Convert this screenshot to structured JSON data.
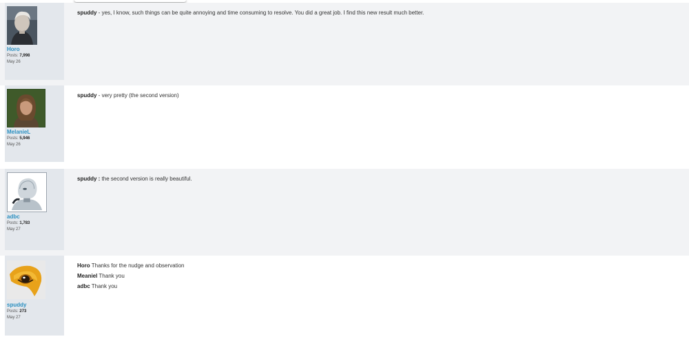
{
  "posts": [
    {
      "user": "Horo",
      "posts_label": "Posts:",
      "posts_count": "7,998",
      "date": "May 26",
      "lines": [
        {
          "bold": "spuddy",
          "text": " - yes, I know, such things can be quite annoying and time consuming to resolve. You did a great job. I find this new result much better."
        }
      ]
    },
    {
      "user": "MelanieL",
      "posts_label": "Posts:",
      "posts_count": "5,946",
      "date": "May 26",
      "lines": [
        {
          "bold": "spuddy",
          "text": " - very pretty (the second version)"
        }
      ]
    },
    {
      "user": "adbc",
      "posts_label": "Posts:",
      "posts_count": "1,783",
      "date": "May 27",
      "lines": [
        {
          "bold": "spuddy :",
          "text": " the second version is really beautiful."
        }
      ]
    },
    {
      "user": "spuddy",
      "posts_label": "Posts:",
      "posts_count": "273",
      "date": "May 27",
      "lines": [
        {
          "bold": "Horo",
          "text": " Thanks for the nudge and observation"
        },
        {
          "bold": "Meaniel",
          "text": "  Thank you"
        },
        {
          "bold": "adbc",
          "text": "  Thank you"
        }
      ]
    }
  ],
  "colors": {
    "username": "#2a8fc0",
    "user_column": "#e3e7ec",
    "post_alt_bg": "#f2f3f5"
  }
}
